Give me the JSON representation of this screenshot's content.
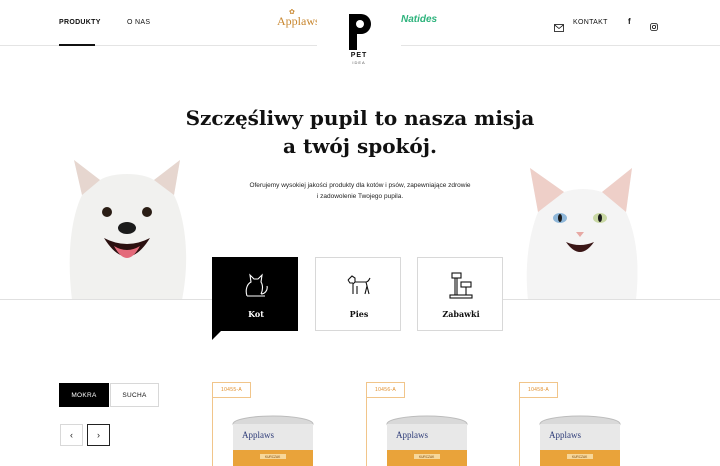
{
  "header": {
    "nav": [
      {
        "label": "PRODUKTY"
      },
      {
        "label": "O NAS"
      }
    ],
    "brand_left": "Applaws",
    "brand_right": "Natides",
    "logo": {
      "text": "PET",
      "sub": "IDEA"
    },
    "kontakt_label": "KONTAKT",
    "facebook_glyph": "f",
    "icons": [
      "mail-icon",
      "facebook-icon",
      "instagram-icon"
    ]
  },
  "hero": {
    "title_line1": "Szczęśliwy pupil to nasza misja",
    "title_line2": "a twój spokój.",
    "subtitle_line1": "Oferujemy wysokiej jakości produkty dla kotów i psów, zapewniające zdrowie",
    "subtitle_line2": "i zadowolenie Twojego pupila."
  },
  "categories": [
    {
      "label": "Kot",
      "icon": "cat-icon",
      "active": true
    },
    {
      "label": "Pies",
      "icon": "dog-icon",
      "active": false
    },
    {
      "label": "Zabawki",
      "icon": "cat-tree-icon",
      "active": false
    }
  ],
  "filters": [
    {
      "label": "MOKRA",
      "active": true
    },
    {
      "label": "SUCHA",
      "active": false
    }
  ],
  "pager": {
    "prev": "‹",
    "next": "›"
  },
  "products": [
    {
      "badge": "10455-A",
      "brand": "Applaws",
      "flavor": "KURCZAK"
    },
    {
      "badge": "10456-A",
      "brand": "Applaws",
      "flavor": "KURCZAK"
    },
    {
      "badge": "10458-A",
      "brand": "Applaws",
      "flavor": "KURCZAK"
    }
  ],
  "colors": {
    "accent": "#000000",
    "applaws": "#c8862e",
    "natides": "#2db37c",
    "badge_border": "#f1c58a",
    "can_gold": "#e9a33a"
  }
}
